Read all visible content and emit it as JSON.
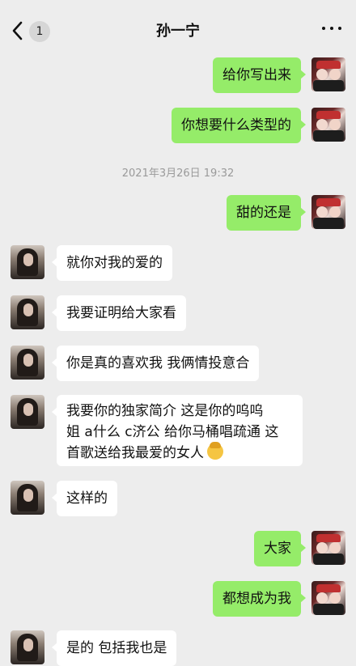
{
  "header": {
    "back_badge": "1",
    "title": "孙一宁"
  },
  "timestamp": "2021年3月26日 19:32",
  "messages": [
    {
      "side": "right",
      "text": "给你写出来"
    },
    {
      "side": "right",
      "text": "你想要什么类型的"
    },
    {
      "side": "right",
      "text": "甜的还是"
    },
    {
      "side": "left",
      "text": "就你对我的爱的"
    },
    {
      "side": "left",
      "text": "我要证明给大家看"
    },
    {
      "side": "left",
      "text": "你是真的喜欢我 我俩情投意合"
    },
    {
      "side": "left",
      "text_line1": "我要你的独家简介 这是你的呜呜",
      "text_line2": "姐 a什么 c济公 给你马桶唱疏通 这",
      "text_line3": "首歌送给我最爱的女人",
      "emoji": "woman-emoji"
    },
    {
      "side": "left",
      "text": "这样的"
    },
    {
      "side": "right",
      "text": "大家"
    },
    {
      "side": "right",
      "text": "都想成为我"
    },
    {
      "side": "left",
      "text": "是的 包括我也是"
    }
  ],
  "icons": {
    "back": "chevron-left-icon",
    "more": "more-dots-icon"
  }
}
